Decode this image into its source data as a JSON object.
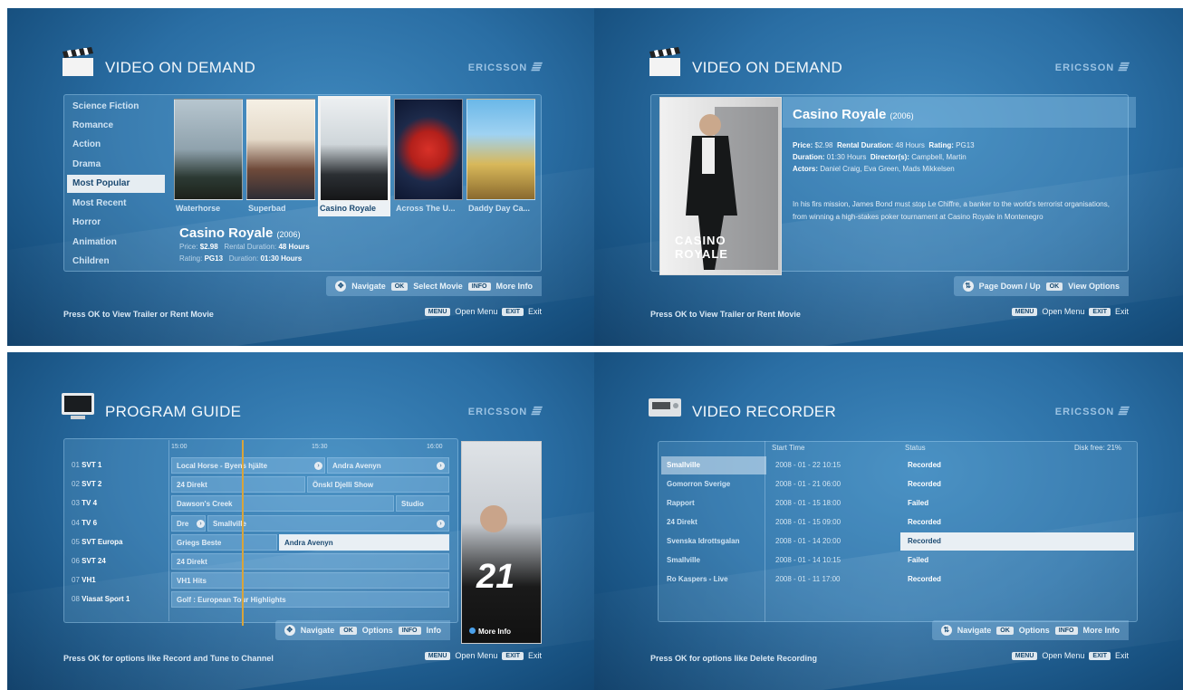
{
  "colors": {
    "bg_dark": "#17507f",
    "bg_light": "#3f88bd",
    "highlight": "#e9eff4",
    "timeline": "#d8a43c"
  },
  "brand": "ERICSSON",
  "common": {
    "open_menu_key": "MENU",
    "open_menu_label": "Open Menu",
    "exit_key": "EXIT",
    "exit_label": "Exit"
  },
  "vod_browse": {
    "title": "VIDEO ON DEMAND",
    "icon": "clapperboard-icon",
    "categories": [
      "Science Fiction",
      "Romance",
      "Action",
      "Drama",
      "Most Popular",
      "Most Recent",
      "Horror",
      "Animation",
      "Children"
    ],
    "selected_category": "Most Popular",
    "posters": [
      "Waterhorse",
      "Superbad",
      "Casino Royale",
      "Across The U...",
      "Daddy Day Ca..."
    ],
    "selected_poster": "Casino Royale",
    "info": {
      "title": "Casino Royale",
      "year": "(2006)",
      "price_label": "Price:",
      "price": "$2.98",
      "rental_label": "Rental Duration:",
      "rental": "48 Hours",
      "rating_label": "Rating:",
      "rating": "PG13",
      "duration_label": "Duration:",
      "duration": "01:30 Hours"
    },
    "hints": {
      "navigate": "Navigate",
      "ok_key": "OK",
      "ok_label": "Select Movie",
      "info_key": "INFO",
      "info_label": "More Info"
    },
    "footer": "Press OK to View Trailer or Rent Movie"
  },
  "vod_detail": {
    "title": "VIDEO ON DEMAND",
    "movie_title": "Casino Royale",
    "year": "(2006)",
    "poster_text": "CASINO ROYALE",
    "line1": {
      "price_label": "Price:",
      "price": "$2.98",
      "rental_label": "Rental Duration:",
      "rental": "48 Hours",
      "rating_label": "Rating:",
      "rating": "PG13"
    },
    "line2": {
      "duration_label": "Duration:",
      "duration": "01:30 Hours",
      "director_label": "Director(s):",
      "director": "Campbell, Martin"
    },
    "line3": {
      "actors_label": "Actors:",
      "actors": "Daniel Craig, Eva Green, Mads Mikkelsen"
    },
    "synopsis": "In his firs mission, James Bond must stop Le Chiffre, a banker to the world's terrorist organisations, from winning a high-stakes poker tournament at Casino Royale in Montenegro",
    "hints": {
      "page_label": "Page Down / Up",
      "ok_key": "OK",
      "ok_label": "View Options"
    },
    "footer": "Press OK to View Trailer or Rent Movie"
  },
  "program_guide": {
    "title": "PROGRAM GUIDE",
    "times": [
      "15:00",
      "15:30",
      "16:00"
    ],
    "channels": [
      {
        "num": "01",
        "name": "SVT 1"
      },
      {
        "num": "02",
        "name": "SVT 2"
      },
      {
        "num": "03",
        "name": "TV 4"
      },
      {
        "num": "04",
        "name": "TV 6"
      },
      {
        "num": "05",
        "name": "SVT Europa"
      },
      {
        "num": "06",
        "name": "SVT 24"
      },
      {
        "num": "07",
        "name": "VH1"
      },
      {
        "num": "08",
        "name": "Viasat Sport 1"
      }
    ],
    "programs": {
      "r0a": "Local Horse - Byens hjälte",
      "r0b": "Andra Avenyn",
      "r1a": "24 Direkt",
      "r1b": "Önskl Djelli Show",
      "r2a": "Dawson's Creek",
      "r2b": "Studio",
      "r3a": "Dre",
      "r3b": "Smallville",
      "r4a": "Griegs Beste",
      "r4b": "Andra Avenyn",
      "r5a": "24 Direkt",
      "r6a": "VH1 Hits",
      "r7a": "Golf : European Tour Highlights"
    },
    "side_poster_text": "21",
    "side_label": "More Info",
    "hints": {
      "navigate": "Navigate",
      "ok_key": "OK",
      "ok_label": "Options",
      "info_key": "INFO",
      "info_label": "Info"
    },
    "footer": "Press OK for options like Record and Tune to Channel"
  },
  "video_recorder": {
    "title": "VIDEO RECORDER",
    "col_start": "Start Time",
    "col_status": "Status",
    "disk_free": "Disk free: 21%",
    "rows": [
      {
        "name": "Smallville",
        "time": "2008 - 01 - 22  10:15",
        "status": "Recorded"
      },
      {
        "name": "Gomorron Sverige",
        "time": "2008 - 01 - 21  06:00",
        "status": "Recorded"
      },
      {
        "name": "Rapport",
        "time": "2008 - 01 - 15  18:00",
        "status": "Failed"
      },
      {
        "name": "24 Direkt",
        "time": "2008 - 01 - 15  09:00",
        "status": "Recorded"
      },
      {
        "name": "Svenska Idrottsgalan",
        "time": "2008 - 01 - 14  20:00",
        "status": "Recorded"
      },
      {
        "name": "Smallville",
        "time": "2008 - 01 - 14  10:15",
        "status": "Failed"
      },
      {
        "name": "Ro Kaspers - Live",
        "time": "2008 - 01 - 11  17:00",
        "status": "Recorded"
      }
    ],
    "hints": {
      "navigate": "Navigate",
      "ok_key": "OK",
      "ok_label": "Options",
      "info_key": "INFO",
      "info_label": "More Info"
    },
    "footer": "Press OK for options like Delete Recording"
  }
}
